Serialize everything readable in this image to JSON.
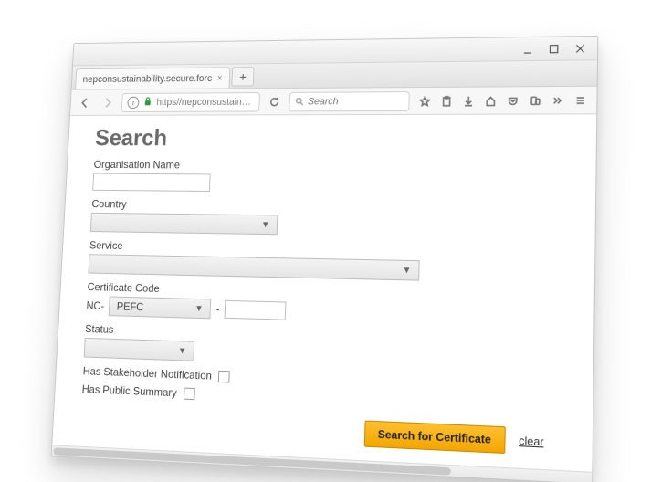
{
  "browser": {
    "tab_title": "nepconsustainability.secure.forc",
    "url_display": "https//nepconsustainabilit",
    "search_placeholder": "Search"
  },
  "page": {
    "title": "Search",
    "org_label": "Organisation Name",
    "org_value": "",
    "country_label": "Country",
    "country_value": "",
    "service_label": "Service",
    "service_value": "",
    "cert_label": "Certificate Code",
    "cert_prefix": "NC-",
    "cert_scheme": "PEFC",
    "cert_dash": "-",
    "cert_number": "",
    "status_label": "Status",
    "status_value": "",
    "stakeholder_label": "Has Stakeholder Notification",
    "public_summary_label": "Has Public Summary",
    "search_button": "Search for Certificate",
    "clear_link": "clear"
  }
}
